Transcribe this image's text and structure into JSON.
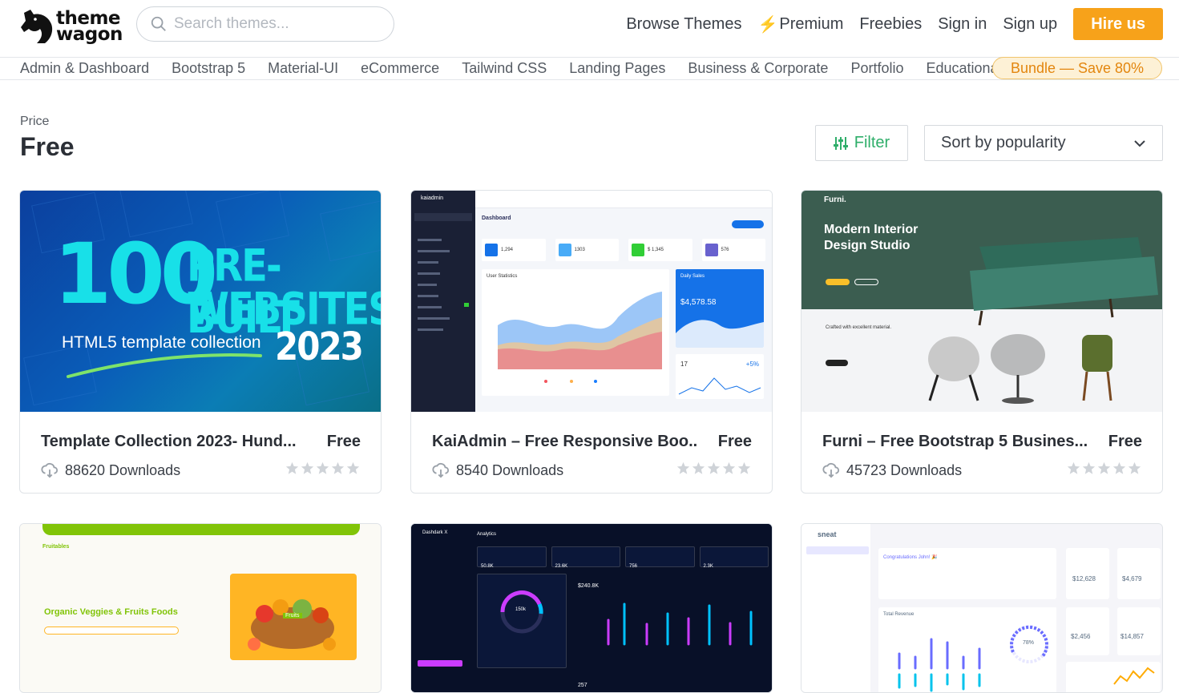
{
  "header": {
    "logo_line1": "theme",
    "logo_line2": "wagon",
    "search_placeholder": "Search themes...",
    "nav": {
      "browse": "Browse Themes",
      "premium": "Premium",
      "freebies": "Freebies",
      "signin": "Sign in",
      "signup": "Sign up",
      "hire": "Hire us"
    }
  },
  "categories": [
    "Admin & Dashboard",
    "Bootstrap 5",
    "Material-UI",
    "eCommerce",
    "Tailwind CSS",
    "Landing Pages",
    "Business & Corporate",
    "Portfolio",
    "Educational"
  ],
  "bundle_label": "Bundle — Save 80%",
  "page": {
    "price_label": "Price",
    "price_title": "Free",
    "filter_label": "Filter",
    "sort_label": "Sort by popularity"
  },
  "cards": [
    {
      "title": "Template Collection 2023- Hund...",
      "price": "Free",
      "downloads": "88620 Downloads",
      "thumb": {
        "big": "100",
        "line1": "PRE-BUILT",
        "line2": "WEBSITES",
        "sub": "HTML5 template collection",
        "year": "2023"
      }
    },
    {
      "title": "KaiAdmin – Free Responsive Boo...",
      "price": "Free",
      "downloads": "8540 Downloads",
      "thumb": {
        "brand": "kaiadmin",
        "heading": "Dashboard",
        "stat1": "1,294",
        "stat2": "1303",
        "stat3": "$ 1,345",
        "stat4": "576",
        "chart": "User Statistics",
        "sales": "$4,578.58",
        "sales_label": "Daily Sales",
        "users": "17",
        "growth": "+5%"
      }
    },
    {
      "title": "Furni – Free Bootstrap 5 Busines...",
      "price": "Free",
      "downloads": "45723 Downloads",
      "thumb": {
        "brand": "Furni.",
        "headline1": "Modern Interior",
        "headline2": "Design Studio",
        "crafted": "Crafted with excellent material."
      }
    }
  ],
  "cards_row2": [
    {
      "brand": "Fruitables",
      "headline": "Organic Veggies & Fruits Foods",
      "badge": "Fruits"
    },
    {
      "brand": "Dashdark X",
      "section": "Analytics",
      "m1": "50.8K",
      "m2": "23.6K",
      "m3": "756",
      "m4": "2.3K",
      "revenue": "$240.8K",
      "visitors": "150k",
      "products": "257"
    },
    {
      "brand": "sneat",
      "congrats": "Congratulations John! 🎉",
      "profit": "$12,628",
      "sales": "$4,679",
      "payments": "$2,456",
      "transactions": "$14,857",
      "growth": "78%",
      "total_rev": "Total Revenue"
    }
  ],
  "colors": {
    "accent": "#f7a21a",
    "green": "#2fae6a",
    "star": "#cfd3d8"
  }
}
